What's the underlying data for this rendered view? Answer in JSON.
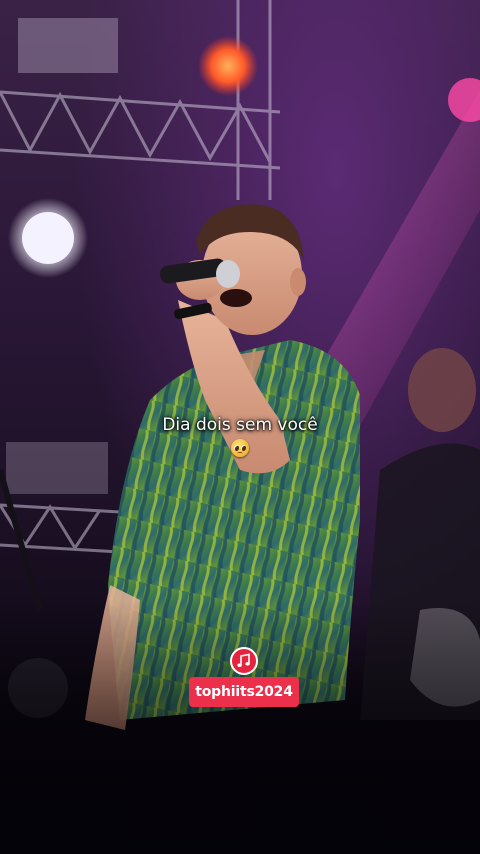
{
  "caption": {
    "line1": "Dia dois sem você",
    "emoji": "pleading-face-emoji"
  },
  "watermark": {
    "icon": "music-notes-icon",
    "username": "tophiits2024",
    "badge_color": "#e5253f",
    "tag_color": "#ec2f4b"
  }
}
